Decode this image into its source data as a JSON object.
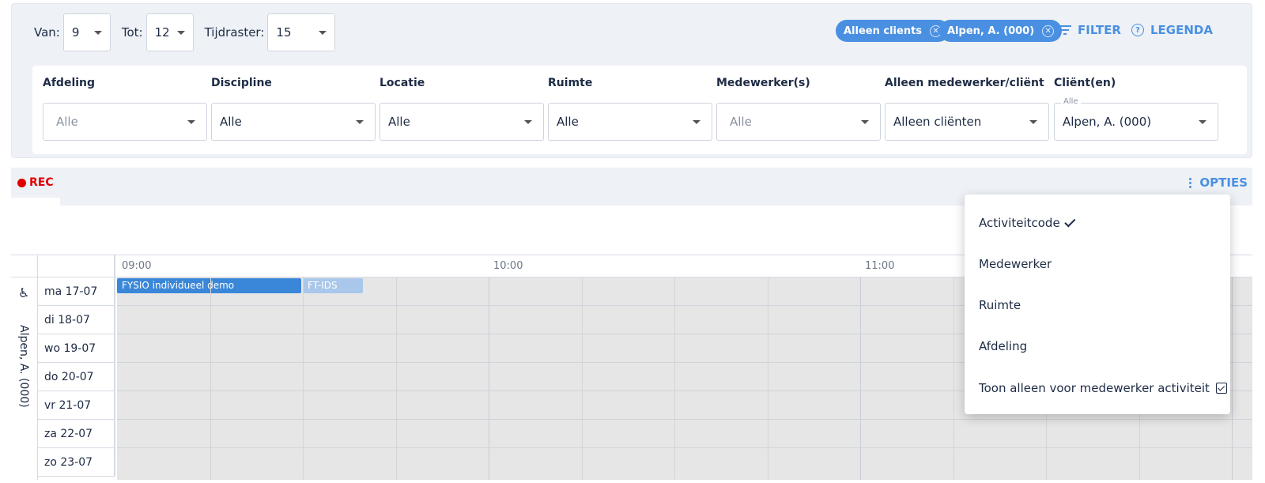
{
  "time": {
    "van_label": "Van:",
    "van_value": "9",
    "tot_label": "Tot:",
    "tot_value": "12",
    "raster_label": "Tijdraster:",
    "raster_value": "15"
  },
  "chips": [
    {
      "label": "Alleen clients"
    },
    {
      "label": "Alpen, A. (000)"
    }
  ],
  "links": {
    "filter": "FILTER",
    "legenda": "LEGENDA"
  },
  "filters": [
    {
      "label": "Afdeling",
      "value": "Alle",
      "placeholder": true
    },
    {
      "label": "Discipline",
      "value": "Alle"
    },
    {
      "label": "Locatie",
      "value": "Alle"
    },
    {
      "label": "Ruimte",
      "value": "Alle"
    },
    {
      "label": "Medewerker(s)",
      "value": "Alle",
      "placeholder": true
    },
    {
      "label": "Alleen medewerker/cliënt",
      "value": "Alleen cliënten"
    },
    {
      "label": "Cliënt(en)",
      "value": "Alpen, A. (000)",
      "mini": "Alle"
    }
  ],
  "rec_label": "REC",
  "opties_label": "OPTIES",
  "calendar": {
    "hours": [
      "09:00",
      "10:00",
      "11:00"
    ],
    "client": "Alpen, A. (000)",
    "days": [
      "ma 17-07",
      "di 18-07",
      "wo 19-07",
      "do 20-07",
      "vr 21-07",
      "za 22-07",
      "zo 23-07"
    ],
    "events": [
      {
        "label": "FYSIO individueel demo",
        "color": "#3a87d9"
      },
      {
        "label": "FT-IDS",
        "color": "#a9c7ea"
      }
    ]
  },
  "menu": {
    "items": [
      {
        "label": "Activiteitcode",
        "mark": "check"
      },
      {
        "label": "Medewerker"
      },
      {
        "label": "Ruimte"
      },
      {
        "label": "Afdeling"
      },
      {
        "label": "Toon alleen voor medewerker activiteit",
        "mark": "checkbox"
      }
    ]
  },
  "colors": {
    "accent": "#4a90e2",
    "rec": "#e00000",
    "text": "#1d2b44"
  }
}
